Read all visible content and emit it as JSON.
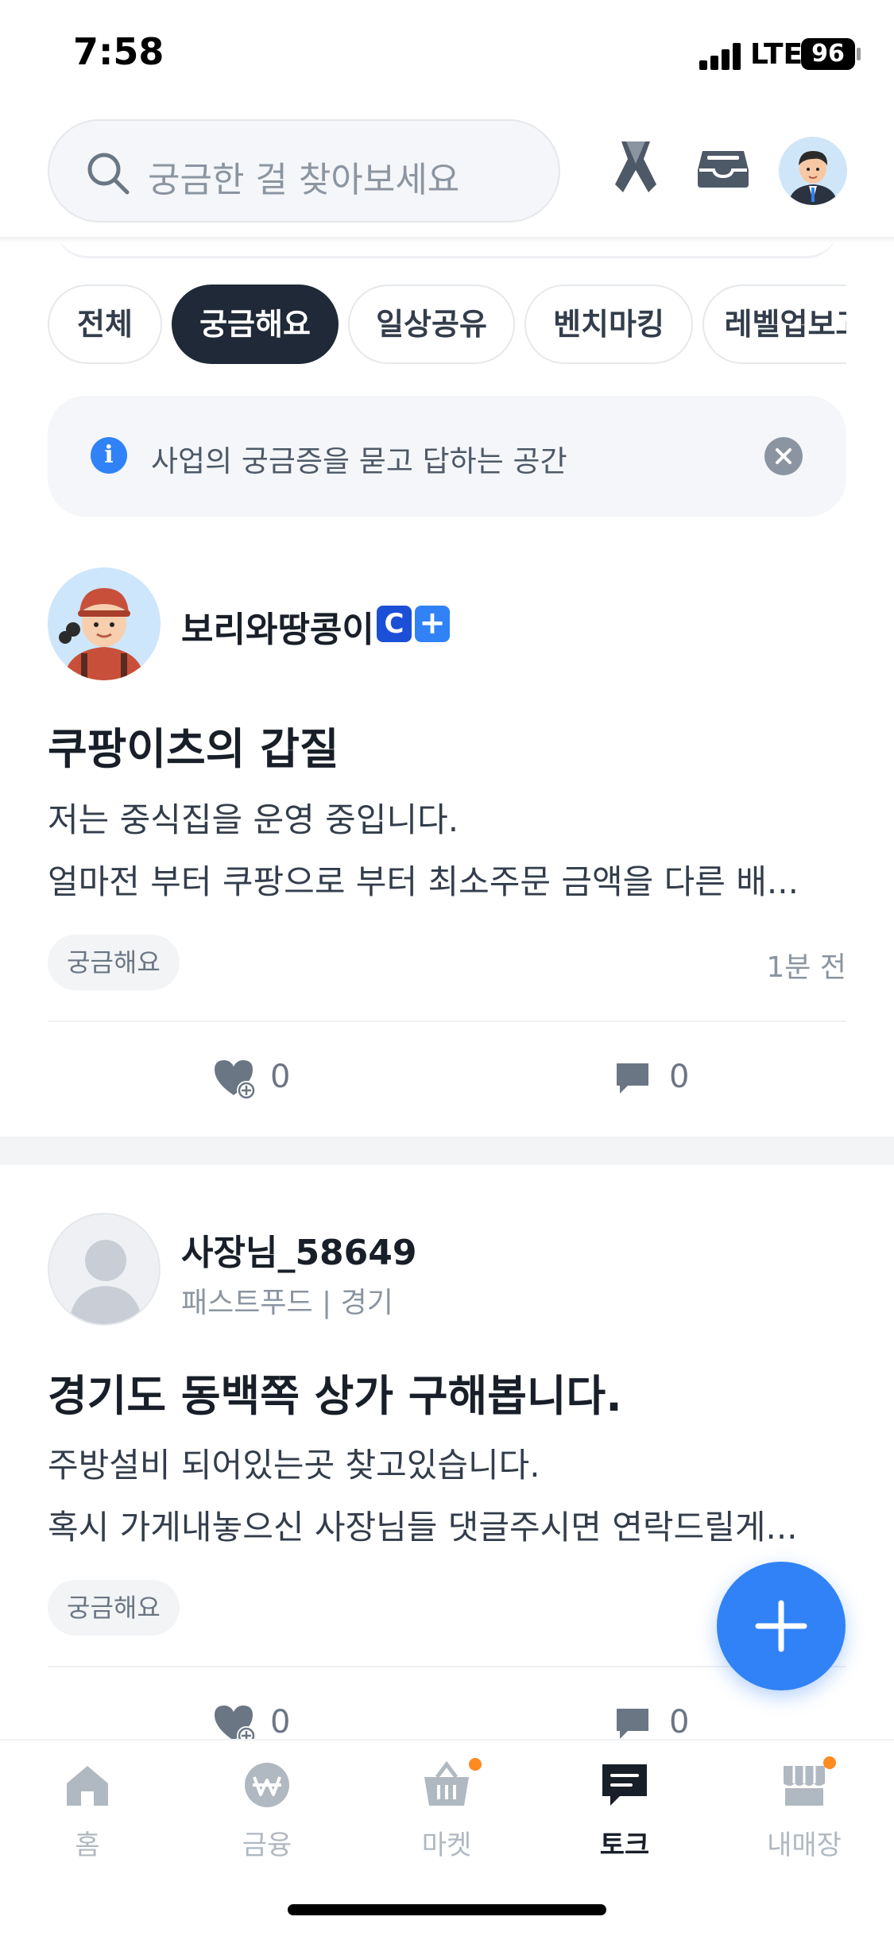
{
  "status_bar": {
    "time": "7:58",
    "network": "LTE",
    "battery": "96"
  },
  "header": {
    "search_placeholder": "궁금한 걸 찾아보세요"
  },
  "chips": [
    {
      "label": "전체",
      "active": false
    },
    {
      "label": "궁금해요",
      "active": true
    },
    {
      "label": "일상공유",
      "active": false
    },
    {
      "label": "벤치마킹",
      "active": false
    },
    {
      "label": "레벨업보고",
      "active": false
    }
  ],
  "notice": {
    "text": "사업의 궁금증을 묻고 답하는 공간",
    "info_icon_glyph": "i"
  },
  "posts": [
    {
      "author": "보리와땅콩이",
      "badges": [
        "C",
        "+"
      ],
      "title": "쿠팡이츠의 갑질",
      "body_line1": "저는 중식집을 운영 중입니다.",
      "body_line2": "얼마전 부터 쿠팡으로 부터 최소주문 금액을 다른 배...",
      "tag": "궁금해요",
      "time_ago": "1분 전",
      "likes": "0",
      "comments": "0"
    },
    {
      "author": "사장님_58649",
      "meta": "패스트푸드 | 경기",
      "title": "경기도 동백쪽 상가 구해봅니다.",
      "body_line1": "주방설비 되어있는곳 찾고있습니다.",
      "body_line2": "혹시 가게내놓으신 사장님들 댓글주시면 연락드릴게...",
      "tag": "궁금해요",
      "likes": "0",
      "comments": "0"
    }
  ],
  "bottom_nav": [
    {
      "label": "홈",
      "icon": "home-icon",
      "active": false
    },
    {
      "label": "금융",
      "icon": "won-icon",
      "active": false
    },
    {
      "label": "마켓",
      "icon": "basket-icon",
      "active": false
    },
    {
      "label": "토크",
      "icon": "chat-icon",
      "active": true
    },
    {
      "label": "내매장",
      "icon": "store-icon",
      "active": false
    }
  ],
  "colors": {
    "accent": "#3182f6",
    "dark": "#1f2937",
    "notification_dot": "#ff8a1f"
  }
}
